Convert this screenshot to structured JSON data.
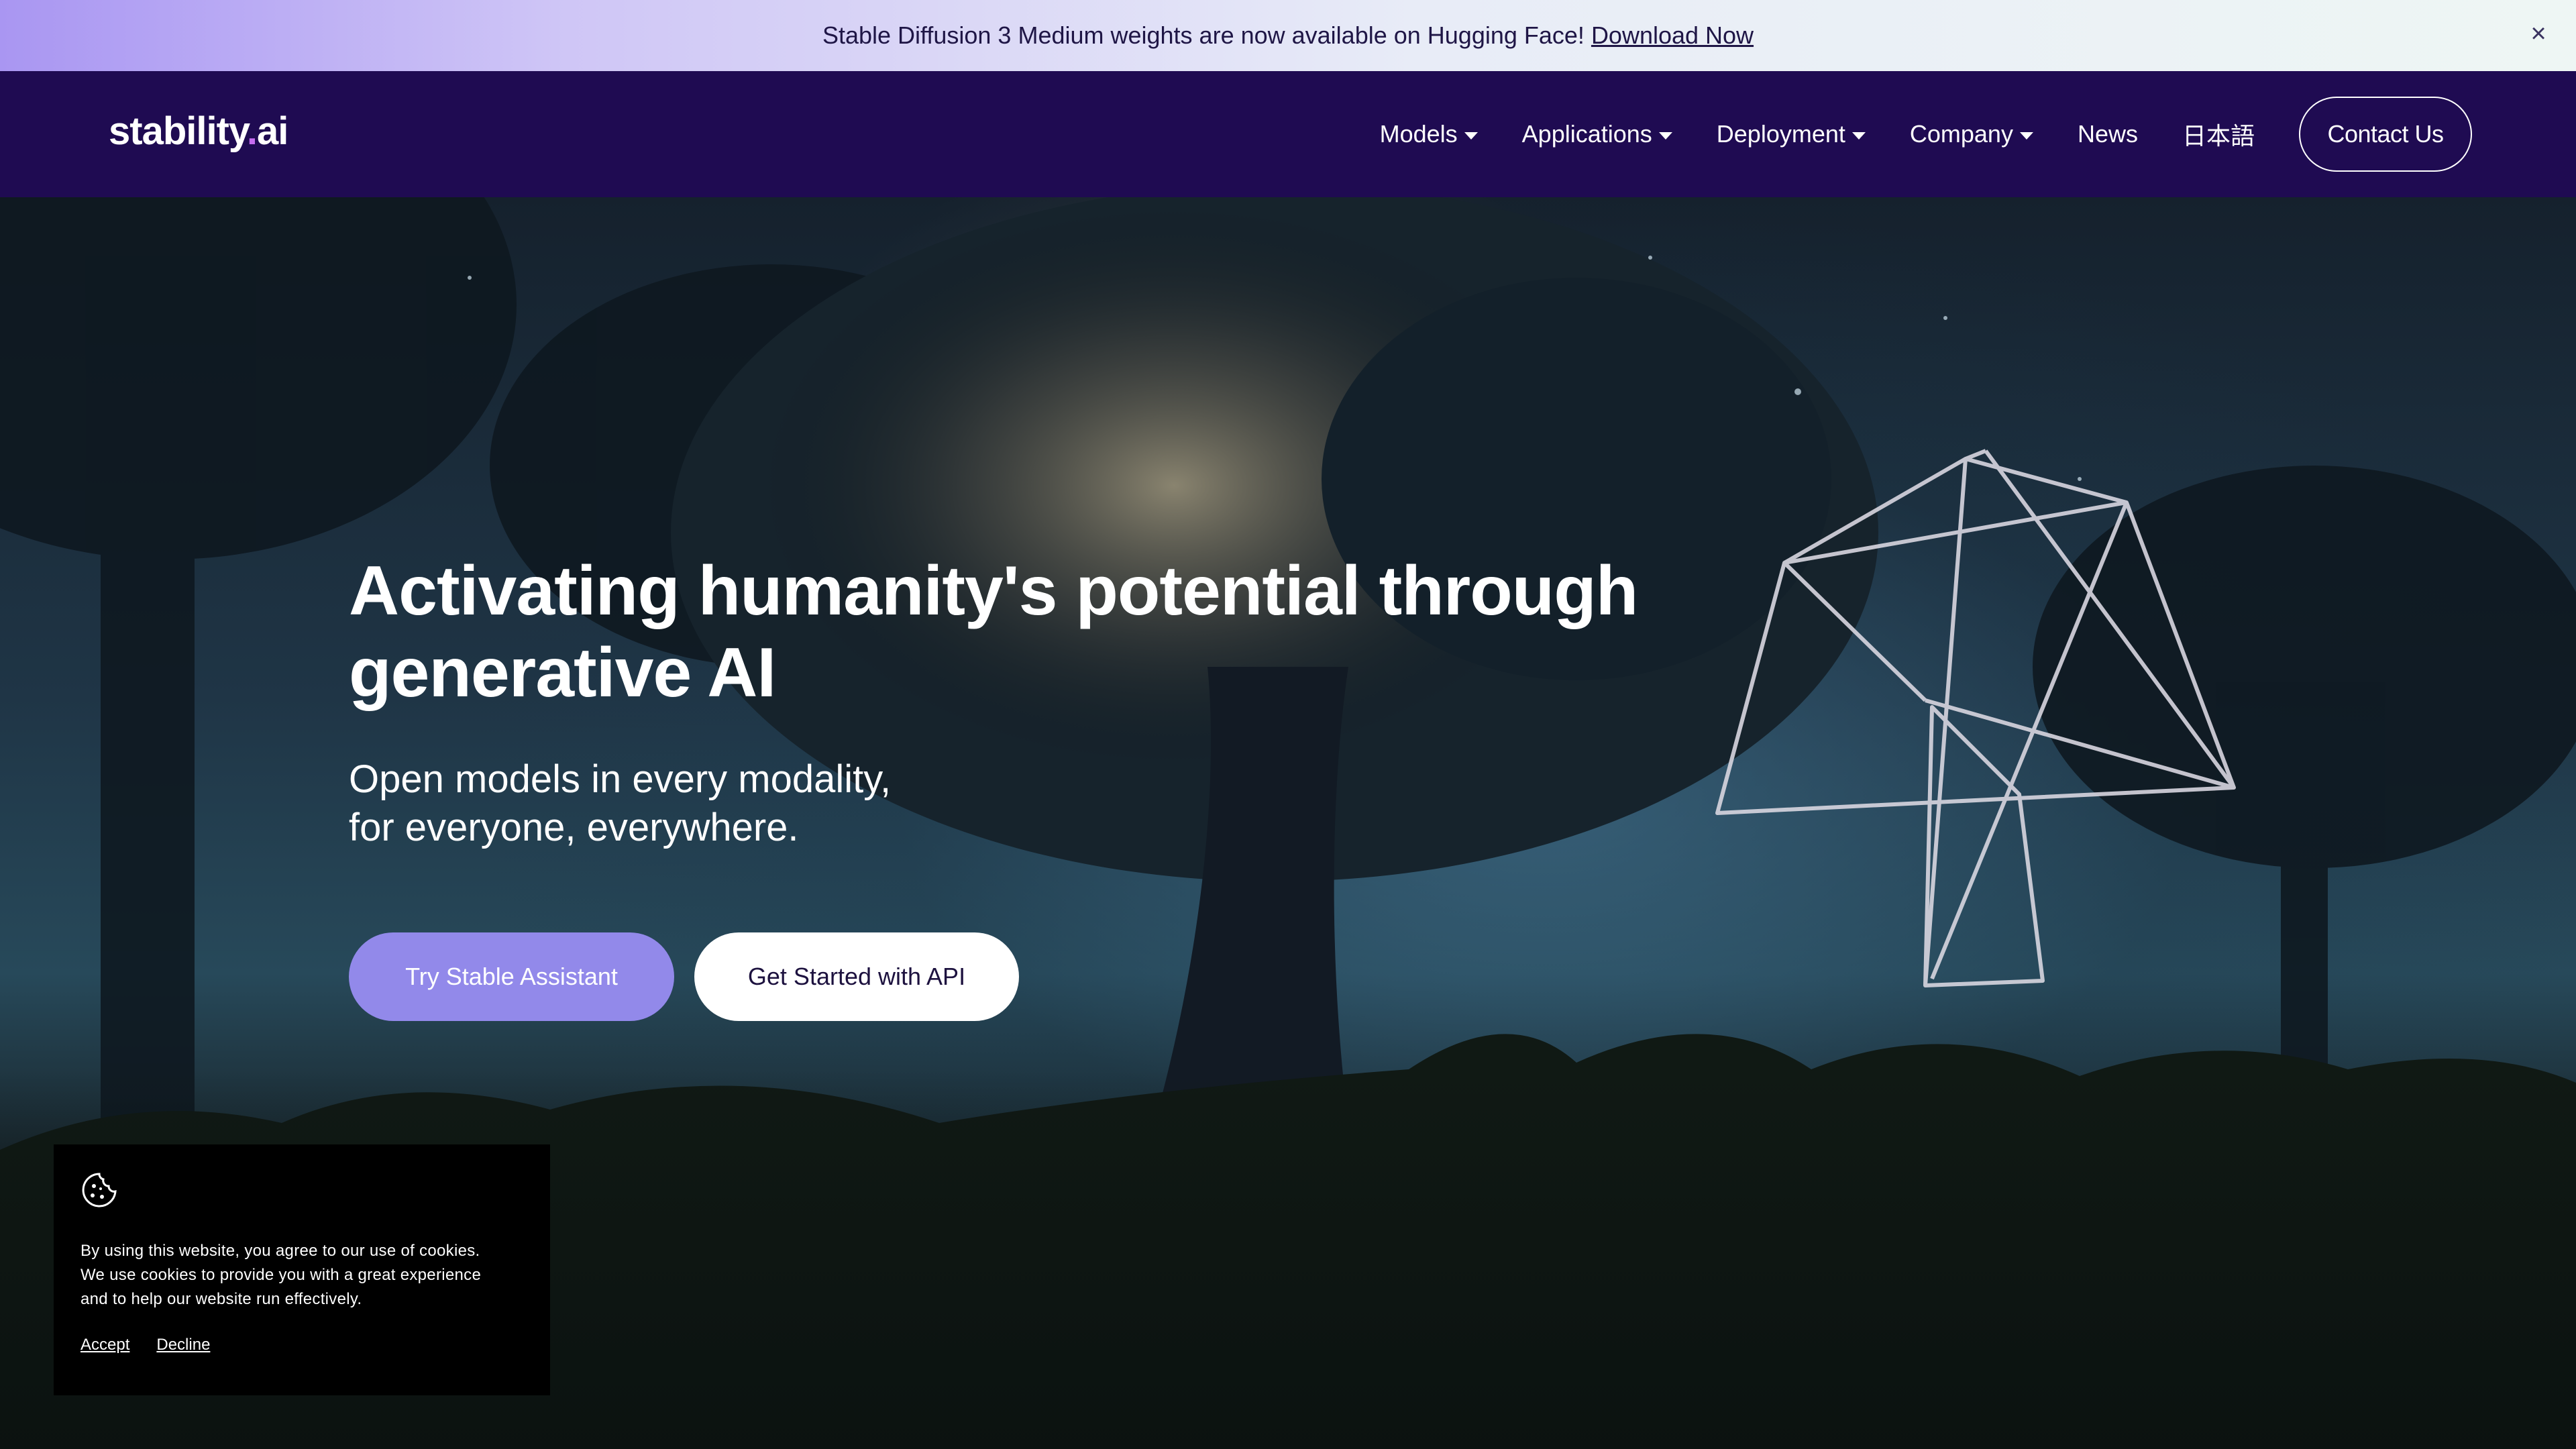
{
  "announcement": {
    "text": "Stable Diffusion 3 Medium weights are now available on Hugging Face!",
    "link_label": "Download Now",
    "close_glyph": "×"
  },
  "nav": {
    "logo_text": "stability",
    "logo_dot": ".",
    "logo_suffix": "ai",
    "items": [
      {
        "label": "Models",
        "dropdown": true
      },
      {
        "label": "Applications",
        "dropdown": true
      },
      {
        "label": "Deployment",
        "dropdown": true
      },
      {
        "label": "Company",
        "dropdown": true
      },
      {
        "label": "News",
        "dropdown": false
      },
      {
        "label": "日本語",
        "dropdown": false
      }
    ],
    "contact_label": "Contact Us"
  },
  "hero": {
    "headline": "Activating humanity's potential through generative AI",
    "subline": [
      "Open models in every modality,",
      "for everyone, everywhere."
    ],
    "cta_primary": "Try Stable Assistant",
    "cta_secondary": "Get Started with API"
  },
  "cookie": {
    "icon": "cookie-icon",
    "lines": [
      "By using this website, you agree to our use of cookies.",
      "We use cookies to provide you with a great experience",
      "and to help our website run effectively."
    ],
    "accept_label": "Accept",
    "decline_label": "Decline"
  },
  "colors": {
    "nav_bg": "#1f0b52",
    "accent": "#9289ea",
    "logo_dot": "#c56cf0"
  }
}
